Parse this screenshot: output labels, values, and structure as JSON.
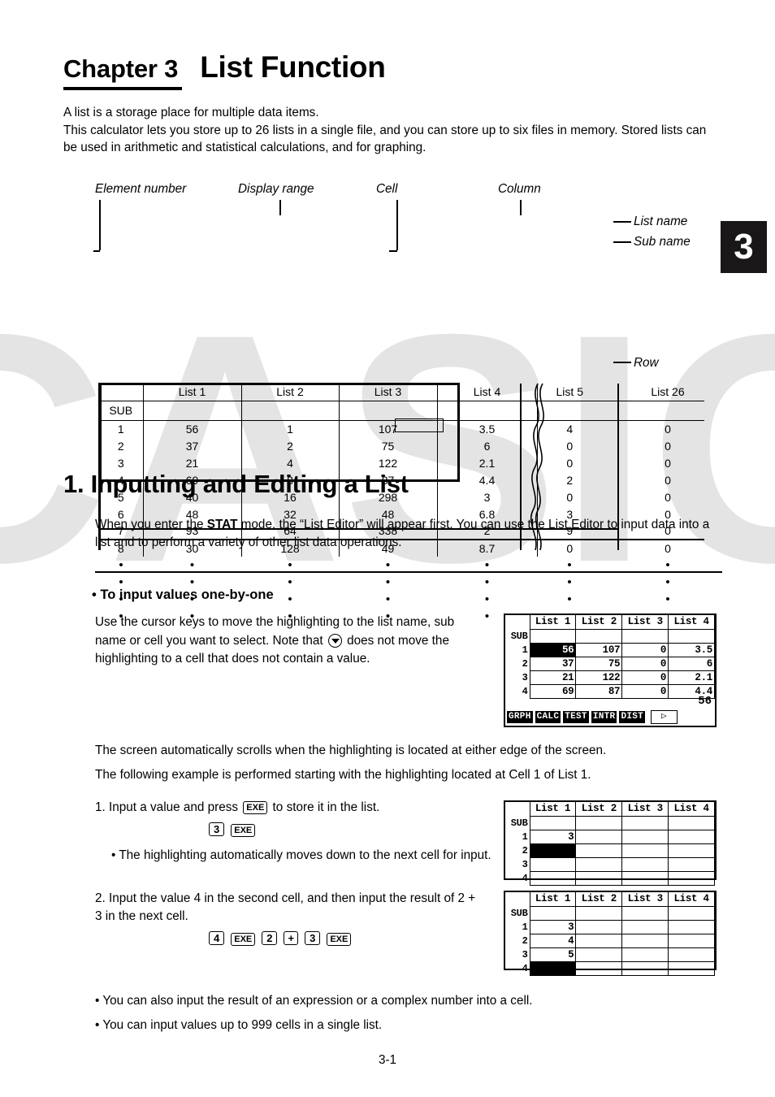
{
  "chapter": {
    "label": "Chapter 3",
    "title": "List Function",
    "tab_number": "3"
  },
  "intro": "A list is a storage place for multiple data items.\nThis calculator lets you store up to 26 lists in a single file, and you can store up to six files in memory.  Stored lists can be used in arithmetic and statistical calculations, and for graphing.",
  "figure": {
    "callouts": {
      "element_number": "Element number",
      "display_range": "Display range",
      "cell": "Cell",
      "column": "Column",
      "list_name": "List name",
      "sub_name": "Sub name",
      "row": "Row"
    },
    "headers": [
      "List  1",
      "List  2",
      "List  3",
      "List  4",
      "List  5",
      "List  26"
    ],
    "sub_label": "SUB",
    "rows": [
      {
        "n": "1",
        "cells": [
          "56",
          "1",
          "107",
          "3.5",
          "4",
          "0"
        ]
      },
      {
        "n": "2",
        "cells": [
          "37",
          "2",
          "75",
          "6",
          "0",
          "0"
        ]
      },
      {
        "n": "3",
        "cells": [
          "21",
          "4",
          "122",
          "2.1",
          "0",
          "0"
        ]
      },
      {
        "n": "4",
        "cells": [
          "69",
          "8",
          "87",
          "4.4",
          "2",
          "0"
        ]
      },
      {
        "n": "5",
        "cells": [
          "40",
          "16",
          "298",
          "3",
          "0",
          "0"
        ]
      },
      {
        "n": "6",
        "cells": [
          "48",
          "32",
          "48",
          "6.8",
          "3",
          "0"
        ]
      },
      {
        "n": "7",
        "cells": [
          "93",
          "64",
          "338",
          "2",
          "9",
          "0"
        ]
      },
      {
        "n": "8",
        "cells": [
          "30",
          "128",
          "49",
          "8.7",
          "0",
          "0"
        ]
      }
    ],
    "ellipsis": "•"
  },
  "section": {
    "heading": "1. Inputting and Editing a List",
    "body_pre": "When you enter the ",
    "body_bold": "STAT",
    "body_post": " mode, the “List Editor” will appear first. You can use the List Editor to input data into a list and to perform a variety of other list data operations."
  },
  "subsection": {
    "heading": "• To input values one-by-one",
    "para_part1": "Use the cursor keys to move the highlighting to the list name, sub name or cell you want to select. Note that ",
    "para_part2": " does not move the highlighting to a cell that does not contain a value.",
    "para_scroll": "The screen automatically scrolls when the highlighting is located at either edge of the screen.",
    "para_example": "The following example is performed starting with the highlighting located at Cell 1 of List 1.",
    "step1_pre": "1. Input a value and press ",
    "step1_key": "EXE",
    "step1_post": " to store it in the list.",
    "step1_keys": [
      "3",
      "EXE"
    ],
    "bullet_step1": "• The highlighting automatically moves down to the next cell for input.",
    "step2": "2. Input the value 4 in the second cell, and then input the result of 2 + 3 in the next cell.",
    "step2_keys": [
      "4",
      "EXE",
      "2",
      "+",
      "3",
      "EXE"
    ],
    "bullet_a": "• You can also input the result of an expression or a complex number into a cell.",
    "bullet_b": "• You can input values up to 999 cells in a single list."
  },
  "lcd_screens": [
    {
      "id": "screen-1",
      "headers": [
        "List 1",
        "List 2",
        "List 3",
        "List 4"
      ],
      "sub_label": "SUB",
      "rows": [
        {
          "n": "1",
          "cells": [
            "56",
            "107",
            "0",
            "3.5"
          ],
          "highlight": 0
        },
        {
          "n": "2",
          "cells": [
            "37",
            "75",
            "0",
            "6"
          ],
          "highlight": -1
        },
        {
          "n": "3",
          "cells": [
            "21",
            "122",
            "0",
            "2.1"
          ],
          "highlight": -1
        },
        {
          "n": "4",
          "cells": [
            "69",
            "87",
            "0",
            "4.4"
          ],
          "highlight": -1
        }
      ],
      "current_value": "56",
      "menu": [
        "GRPH",
        "CALC",
        "TEST",
        "INTR",
        "DIST"
      ],
      "menu_arrow": "▷"
    },
    {
      "id": "screen-2",
      "headers": [
        "List 1",
        "List 2",
        "List 3",
        "List 4"
      ],
      "sub_label": "SUB",
      "rows": [
        {
          "n": "1",
          "cells": [
            "3",
            "",
            "",
            ""
          ],
          "highlight": -1
        },
        {
          "n": "2",
          "cells": [
            "",
            "",
            "",
            ""
          ],
          "highlight": 0
        },
        {
          "n": "3",
          "cells": [
            "",
            "",
            "",
            ""
          ],
          "highlight": -1
        },
        {
          "n": "4",
          "cells": [
            "",
            "",
            "",
            ""
          ],
          "highlight": -1
        }
      ]
    },
    {
      "id": "screen-3",
      "headers": [
        "List 1",
        "List 2",
        "List 3",
        "List 4"
      ],
      "sub_label": "SUB",
      "rows": [
        {
          "n": "1",
          "cells": [
            "3",
            "",
            "",
            ""
          ],
          "highlight": -1
        },
        {
          "n": "2",
          "cells": [
            "4",
            "",
            "",
            ""
          ],
          "highlight": -1
        },
        {
          "n": "3",
          "cells": [
            "5",
            "",
            "",
            ""
          ],
          "highlight": -1
        },
        {
          "n": "4",
          "cells": [
            "",
            "",
            "",
            ""
          ],
          "highlight": 0
        }
      ]
    }
  ],
  "page_number": "3-1",
  "watermark": "CASIO"
}
